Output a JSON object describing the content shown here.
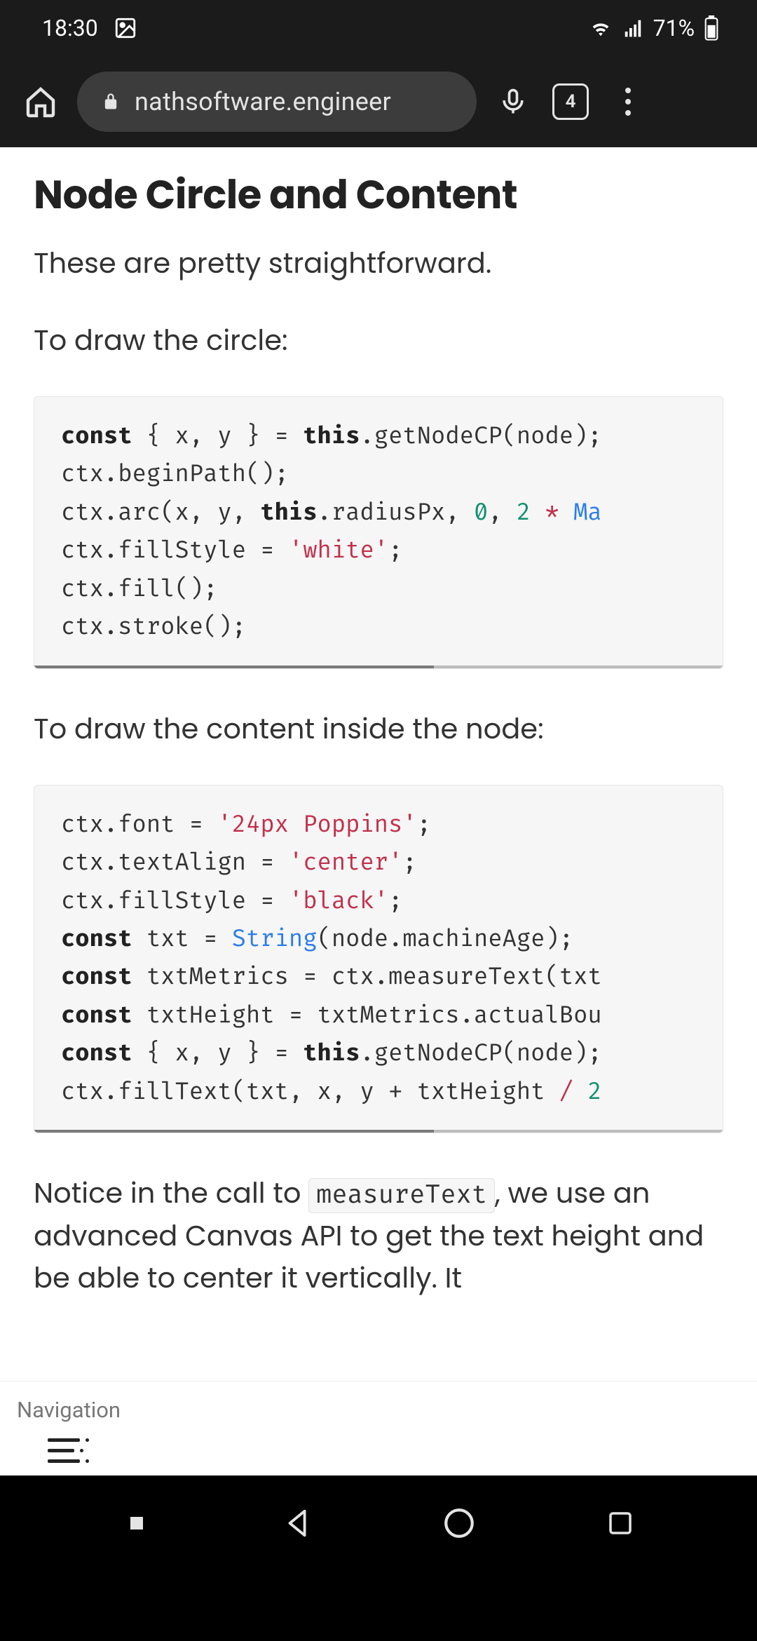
{
  "status": {
    "time": "18:30",
    "battery_pct": "71%"
  },
  "browser": {
    "url": "nathsoftware.engineer",
    "tab_count": "4"
  },
  "article": {
    "heading": "Node Circle and Content",
    "intro_para": "These are pretty straightforward.",
    "lead_in_1": "To draw the circle:",
    "lead_in_2": "To draw the content inside the node:",
    "closing_para_prefix": "Notice in the call to ",
    "closing_inline_code": "measureText",
    "closing_para_suffix": ", we use an advanced Canvas API to get the text height and be able to center it vertically. It",
    "code1": {
      "l1_kw1": "const",
      "l1_rest1": " { x, y } = ",
      "l1_kw2": "this",
      "l1_rest2": ".getNodeCP(node);",
      "l2": "ctx.beginPath();",
      "l3_pre": "ctx.arc(x, y, ",
      "l3_kw": "this",
      "l3_mid": ".radiusPx, ",
      "l3_num1": "0",
      "l3_comma": ", ",
      "l3_num2": "2",
      "l3_star": " * ",
      "l3_tail": "Ma",
      "l4_pre": "ctx.fillStyle = ",
      "l4_str": "'white'",
      "l4_post": ";",
      "l5": "ctx.fill();",
      "l6": "ctx.stroke();"
    },
    "code2": {
      "l1_pre": "ctx.font = ",
      "l1_str": "'24px Poppins'",
      "l1_post": ";",
      "l2_pre": "ctx.textAlign = ",
      "l2_str": "'center'",
      "l2_post": ";",
      "l3_pre": "ctx.fillStyle = ",
      "l3_str": "'black'",
      "l3_post": ";",
      "l4_kw": "const",
      "l4_mid": " txt = ",
      "l4_fn": "String",
      "l4_rest": "(node.machineAge);",
      "l5_kw": "const",
      "l5_rest": " txtMetrics = ctx.measureText(txt",
      "l6_kw": "const",
      "l6_rest": " txtHeight = txtMetrics.actualBou",
      "l7_kw1": "const",
      "l7_mid": " { x, y } = ",
      "l7_kw2": "this",
      "l7_rest": ".getNodeCP(node);",
      "l8_pre": "ctx.fillText(txt, x, y + txtHeight ",
      "l8_op": "/",
      "l8_sp": " ",
      "l8_num": "2"
    }
  },
  "page_nav": {
    "label": "Navigation"
  }
}
